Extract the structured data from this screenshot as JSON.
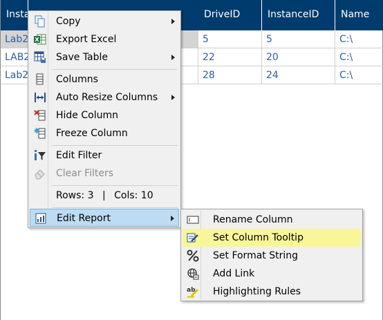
{
  "grid": {
    "headers": [
      "Insta",
      "DriveID",
      "InstanceID",
      "Name"
    ],
    "rows": [
      {
        "c0": "Lab2",
        "drive": "5",
        "instance": "5",
        "name": "C:\\"
      },
      {
        "c0": "LAB2",
        "drive": "22",
        "instance": "20",
        "name": "C:\\"
      },
      {
        "c0": "Lab2",
        "drive": "28",
        "instance": "24",
        "name": "C:\\"
      }
    ]
  },
  "context_menu": {
    "copy": "Copy",
    "export_excel": "Export Excel",
    "save_table": "Save Table",
    "columns": "Columns",
    "auto_resize": "Auto Resize Columns",
    "hide_column": "Hide Column",
    "freeze_column": "Freeze Column",
    "edit_filter": "Edit Filter",
    "clear_filters": "Clear Filters",
    "rows_info": "Rows: 3",
    "info_sep": "|",
    "cols_info": "Cols: 10",
    "edit_report": "Edit Report"
  },
  "submenu": {
    "rename_column": "Rename Column",
    "set_tooltip": "Set Column Tooltip",
    "set_format": "Set Format String",
    "add_link": "Add Link",
    "highlighting": "Highlighting Rules"
  },
  "colors": {
    "header_bg": "#003b6e",
    "cell_text": "#2d5d9c",
    "menu_highlight": "#bcdcf4",
    "submenu_highlight": "#f9f69a"
  }
}
